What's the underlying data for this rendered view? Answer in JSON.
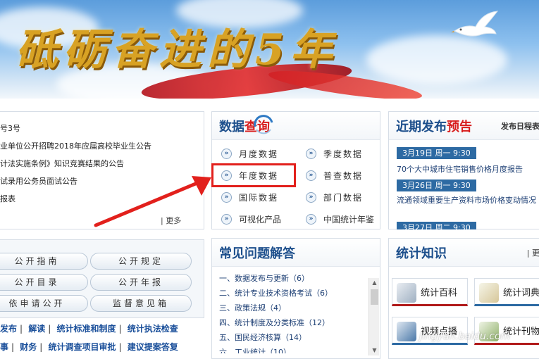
{
  "banner": {
    "title": "砥砺奋进的5年"
  },
  "notices": {
    "items": [
      "号3号",
      "业单位公开招聘2018年应届高校毕业生公告",
      "计法实施条例》知识竞赛结果的公告",
      "试录用公务员面试公告",
      "报表"
    ],
    "more": "| 更多"
  },
  "gov_open": {
    "buttons": [
      "公开指南",
      "公开规定",
      "公开目录",
      "公开年报",
      "依申请公开",
      "监督意见箱"
    ]
  },
  "links": {
    "row1": [
      "发布",
      "解读",
      "统计标准和制度",
      "统计执法检查"
    ],
    "row2": [
      "事",
      "财务",
      "统计调查项目审批",
      "建议提案答复"
    ]
  },
  "data_query": {
    "title_prefix": "数据",
    "title_highlight": "查询",
    "items": [
      "月度数据",
      "季度数据",
      "年度数据",
      "普查数据",
      "国际数据",
      "部门数据",
      "可视化产品",
      "中国统计年鉴"
    ],
    "highlighted": "年度数据"
  },
  "releases": {
    "title_prefix": "近期发布",
    "title_highlight": "预告",
    "schedule_link": "发布日程表",
    "entries": [
      {
        "date": "3月19日  周一  9:30",
        "text": "70个大中城市住宅销售价格月度报告"
      },
      {
        "date": "3月26日  周一  9:30",
        "text": "流通领域重要生产资料市场价格变动情况"
      },
      {
        "date": "3月27日  周二  9:30",
        "text": ""
      }
    ]
  },
  "faq": {
    "title": "常见问题解答",
    "items": [
      "一、数据发布与更新（6）",
      "二、统计专业技术资格考试（6）",
      "三、政策法规（4）",
      "四、统计制度及分类标准（12）",
      "五、国民经济核算（14）",
      "六、工业统计（10）"
    ]
  },
  "knowledge": {
    "title": "统计知识",
    "more": "| 更",
    "cards": [
      "统计百科",
      "统计词典",
      "视频点播",
      "统计刊物"
    ]
  },
  "watermark": "jingyan.baidu.com",
  "colors": {
    "title_blue": "#1d4f8c",
    "accent_red": "#d81e1e",
    "date_bg": "#2d6aa3",
    "highlight": "#e2201c"
  }
}
